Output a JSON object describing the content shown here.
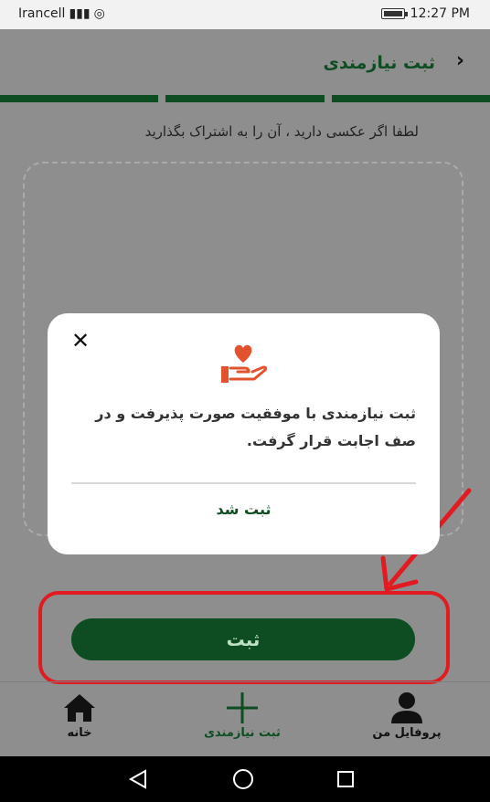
{
  "status_bar": {
    "carrier": "Irancell",
    "time": "12:27 PM"
  },
  "header": {
    "title": "ثبت نیازمندی",
    "back_icon": "chevron-right-icon"
  },
  "progress_segments": 3,
  "hint_text": "لطفا اگر عکسی دارید ، آن را به اشتراک بگذارید",
  "submit_label": "ثبت",
  "modal": {
    "message": "ثبت نیازمندی با موفقیت صورت پذیرفت و در صف اجابت قرار گرفت.",
    "confirm_label": "ثبت شد",
    "icon": "hand-heart-icon"
  },
  "tabs": [
    {
      "label": "خانه",
      "icon": "home-icon"
    },
    {
      "label": "ثبت نیازمندی",
      "icon": "plus-icon"
    },
    {
      "label": "پروفایل من",
      "icon": "user-icon"
    }
  ],
  "colors": {
    "primary": "#0e4d21",
    "highlight": "#e21a22",
    "accent_icon": "#e2532d"
  }
}
